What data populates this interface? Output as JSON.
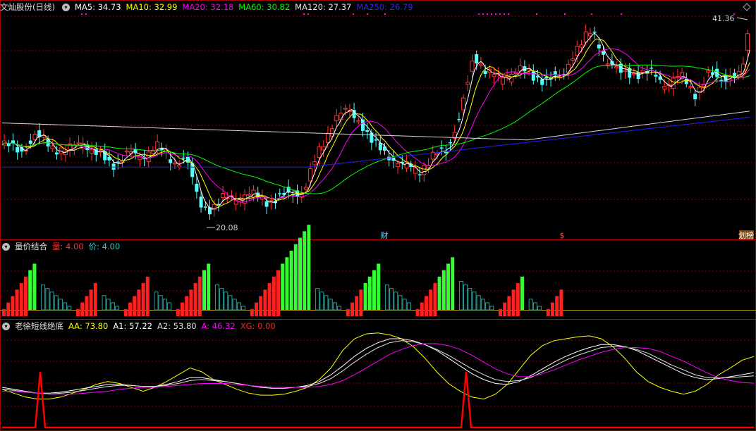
{
  "panel1": {
    "title": "文灿股份(日线)",
    "ma": [
      {
        "label": "MA5: 34.73",
        "color": "#ffffff"
      },
      {
        "label": "MA10: 32.99",
        "color": "#ffff00"
      },
      {
        "label": "MA20: 32.18",
        "color": "#ff00ff"
      },
      {
        "label": "MA60: 30.82",
        "color": "#00ff00"
      },
      {
        "label": "MA120: 27.37",
        "color": "#e8e8e8"
      },
      {
        "label": "MA250: 26.79",
        "color": "#0000ff"
      }
    ],
    "high_label": "41.36",
    "low_label": "20.08",
    "markers": [
      {
        "text": "财"
      },
      {
        "text": "$"
      },
      {
        "text": "划榜"
      }
    ]
  },
  "panel2": {
    "title": "量价结合",
    "items": [
      {
        "label": "量: 4.00",
        "color": "#ff3030"
      },
      {
        "label": "价: 4.00",
        "color": "#28c8c8"
      }
    ]
  },
  "panel3": {
    "title": "老徐短线绝底",
    "items": [
      {
        "label": "AA: 73.80",
        "color": "#ffff00"
      },
      {
        "label": "A1: 57.22",
        "color": "#ffffff"
      },
      {
        "label": "A2: 53.80",
        "color": "#e0e0e0"
      },
      {
        "label": "A: 46.32",
        "color": "#ff00ff"
      },
      {
        "label": "XG: 0.00",
        "color": "#ff0000"
      }
    ]
  },
  "colors": {
    "up": "#ff3232",
    "down": "#54ffff",
    "bg": "#000000",
    "grid": "#8a0000"
  },
  "chart_data": [
    {
      "type": "candlestick",
      "title": "文灿股份(日线)",
      "high_marker": 41.36,
      "low_marker": 20.08,
      "series": [
        {
          "name": "MA5",
          "last": 34.73
        },
        {
          "name": "MA10",
          "last": 32.99
        },
        {
          "name": "MA20",
          "last": 32.18
        },
        {
          "name": "MA60",
          "last": 30.82
        },
        {
          "name": "MA120",
          "last": 27.37
        },
        {
          "name": "MA250",
          "last": 26.79
        }
      ],
      "grid": true
    },
    {
      "type": "bar",
      "title": "量价结合",
      "series": [
        {
          "name": "量",
          "last": 4.0
        },
        {
          "name": "价",
          "last": 4.0
        }
      ],
      "ylim": [
        0,
        10
      ],
      "segments": [
        {
          "type": "red",
          "values": [
            1,
            2,
            3,
            4,
            5,
            6,
            7,
            8
          ],
          "green_tail": 2
        },
        {
          "type": "cyan",
          "values": [
            7,
            6,
            5,
            4,
            3,
            2,
            1
          ]
        },
        {
          "type": "red",
          "values": [
            1,
            2,
            3,
            4,
            5
          ]
        },
        {
          "type": "cyan",
          "values": [
            4,
            3,
            2,
            1
          ]
        },
        {
          "type": "red",
          "values": [
            1,
            2,
            3,
            4,
            5,
            6
          ]
        },
        {
          "type": "cyan",
          "values": [
            5,
            4,
            3,
            2
          ]
        },
        {
          "type": "red",
          "values": [
            1,
            2,
            3,
            4,
            5,
            6,
            7,
            8
          ],
          "green_tail": 2
        },
        {
          "type": "cyan",
          "values": [
            7,
            6,
            5,
            4,
            3,
            2,
            1
          ]
        },
        {
          "type": "red",
          "values": [
            1,
            2,
            3,
            4,
            5,
            6,
            7,
            8,
            9,
            10,
            11,
            12,
            13,
            14
          ],
          "green_tail": 7
        },
        {
          "type": "cyan",
          "values": [
            6,
            5,
            4,
            3,
            2,
            1
          ]
        },
        {
          "type": "red",
          "values": [
            1,
            2,
            3,
            4,
            5,
            6,
            7,
            8
          ],
          "green_tail": 4
        },
        {
          "type": "cyan",
          "values": [
            7,
            6,
            5,
            4,
            3,
            2
          ]
        },
        {
          "type": "red",
          "values": [
            1,
            2,
            3,
            4,
            5,
            6,
            7,
            8,
            9
          ],
          "green_tail": 4
        },
        {
          "type": "cyan",
          "values": [
            8,
            7,
            6,
            5,
            4,
            3,
            2,
            1
          ]
        },
        {
          "type": "red",
          "values": [
            1,
            2,
            3,
            4,
            5,
            6
          ],
          "green_tail": 1
        },
        {
          "type": "cyan",
          "values": [
            3,
            2,
            1
          ]
        },
        {
          "type": "red",
          "values": [
            1,
            2,
            3,
            4
          ]
        }
      ]
    },
    {
      "type": "line",
      "title": "老徐短线绝底",
      "ylim": [
        0,
        100
      ],
      "series": [
        {
          "name": "AA",
          "last": 73.8,
          "color": "#ffff00",
          "values": [
            40,
            36,
            32,
            30,
            30,
            32,
            36,
            40,
            45,
            48,
            46,
            42,
            38,
            42,
            48,
            55,
            62,
            58,
            50,
            45,
            40,
            36,
            34,
            34,
            35,
            38,
            42,
            50,
            62,
            80,
            92,
            97,
            98,
            96,
            92,
            84,
            72,
            58,
            46,
            38,
            32,
            30,
            35,
            45,
            60,
            75,
            85,
            90,
            92,
            94,
            95,
            92,
            84,
            72,
            58,
            48,
            42,
            38,
            35,
            38,
            45,
            55,
            62,
            70,
            73.8
          ]
        },
        {
          "name": "A1",
          "last": 57.22,
          "color": "#ffffff",
          "values": [
            42,
            40,
            38,
            36,
            36,
            37,
            39,
            41,
            43,
            45,
            45,
            44,
            43,
            43,
            45,
            48,
            52,
            52,
            50,
            48,
            46,
            44,
            42,
            41,
            41,
            42,
            44,
            48,
            55,
            64,
            74,
            82,
            88,
            92,
            92,
            90,
            86,
            80,
            72,
            64,
            56,
            50,
            46,
            45,
            48,
            54,
            61,
            68,
            74,
            79,
            83,
            86,
            86,
            84,
            80,
            74,
            68,
            62,
            56,
            52,
            50,
            51,
            53,
            55,
            57.22
          ]
        },
        {
          "name": "A2",
          "last": 53.8,
          "color": "#e0e0e0",
          "values": [
            40,
            39,
            37,
            36,
            35,
            36,
            37,
            39,
            41,
            43,
            44,
            44,
            43,
            43,
            44,
            46,
            49,
            50,
            49,
            48,
            46,
            44,
            43,
            42,
            42,
            42,
            43,
            46,
            51,
            59,
            68,
            76,
            83,
            88,
            90,
            89,
            86,
            81,
            75,
            68,
            61,
            55,
            50,
            48,
            49,
            52,
            58,
            64,
            70,
            75,
            79,
            83,
            84,
            84,
            81,
            77,
            71,
            65,
            60,
            55,
            52,
            52,
            52,
            53,
            53.8
          ]
        },
        {
          "name": "A",
          "last": 46.32,
          "color": "#ff00ff",
          "values": [
            38,
            38,
            37,
            36,
            35,
            35,
            35,
            36,
            37,
            38,
            40,
            41,
            42,
            42,
            43,
            44,
            45,
            46,
            46,
            46,
            45,
            44,
            43,
            42,
            42,
            42,
            42,
            43,
            45,
            49,
            55,
            62,
            69,
            76,
            81,
            85,
            87,
            87,
            85,
            81,
            75,
            68,
            61,
            56,
            53,
            53,
            56,
            60,
            65,
            70,
            74,
            78,
            81,
            83,
            83,
            82,
            79,
            74,
            69,
            63,
            57,
            52,
            49,
            47,
            46.32
          ]
        },
        {
          "name": "XG",
          "last": 0.0,
          "color": "#ff0000"
        }
      ]
    }
  ]
}
